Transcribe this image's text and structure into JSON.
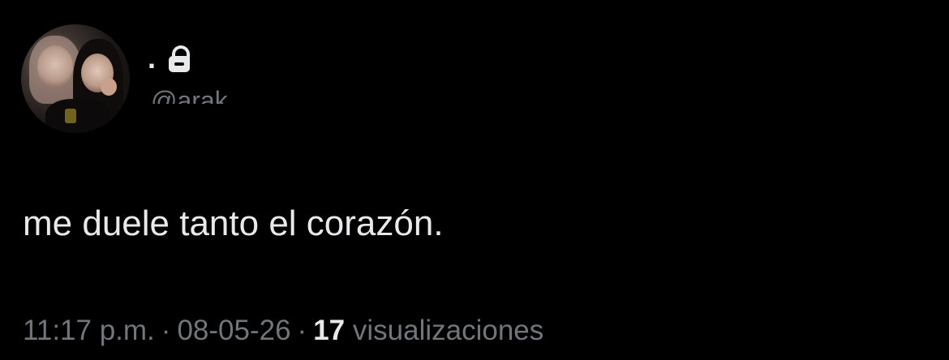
{
  "author": {
    "display_name": ".",
    "handle": "@arak",
    "protected": true,
    "lock_icon": "lock-icon"
  },
  "tweet": {
    "text": "me duele tanto el corazón."
  },
  "meta": {
    "time": "11:17 p.m.",
    "separator": "·",
    "date": "08-05-26",
    "views_count": "17",
    "views_label": "visualizaciones"
  },
  "colors": {
    "background": "#000000",
    "primary_text": "#e7e9ea",
    "secondary_text": "#71767b"
  }
}
